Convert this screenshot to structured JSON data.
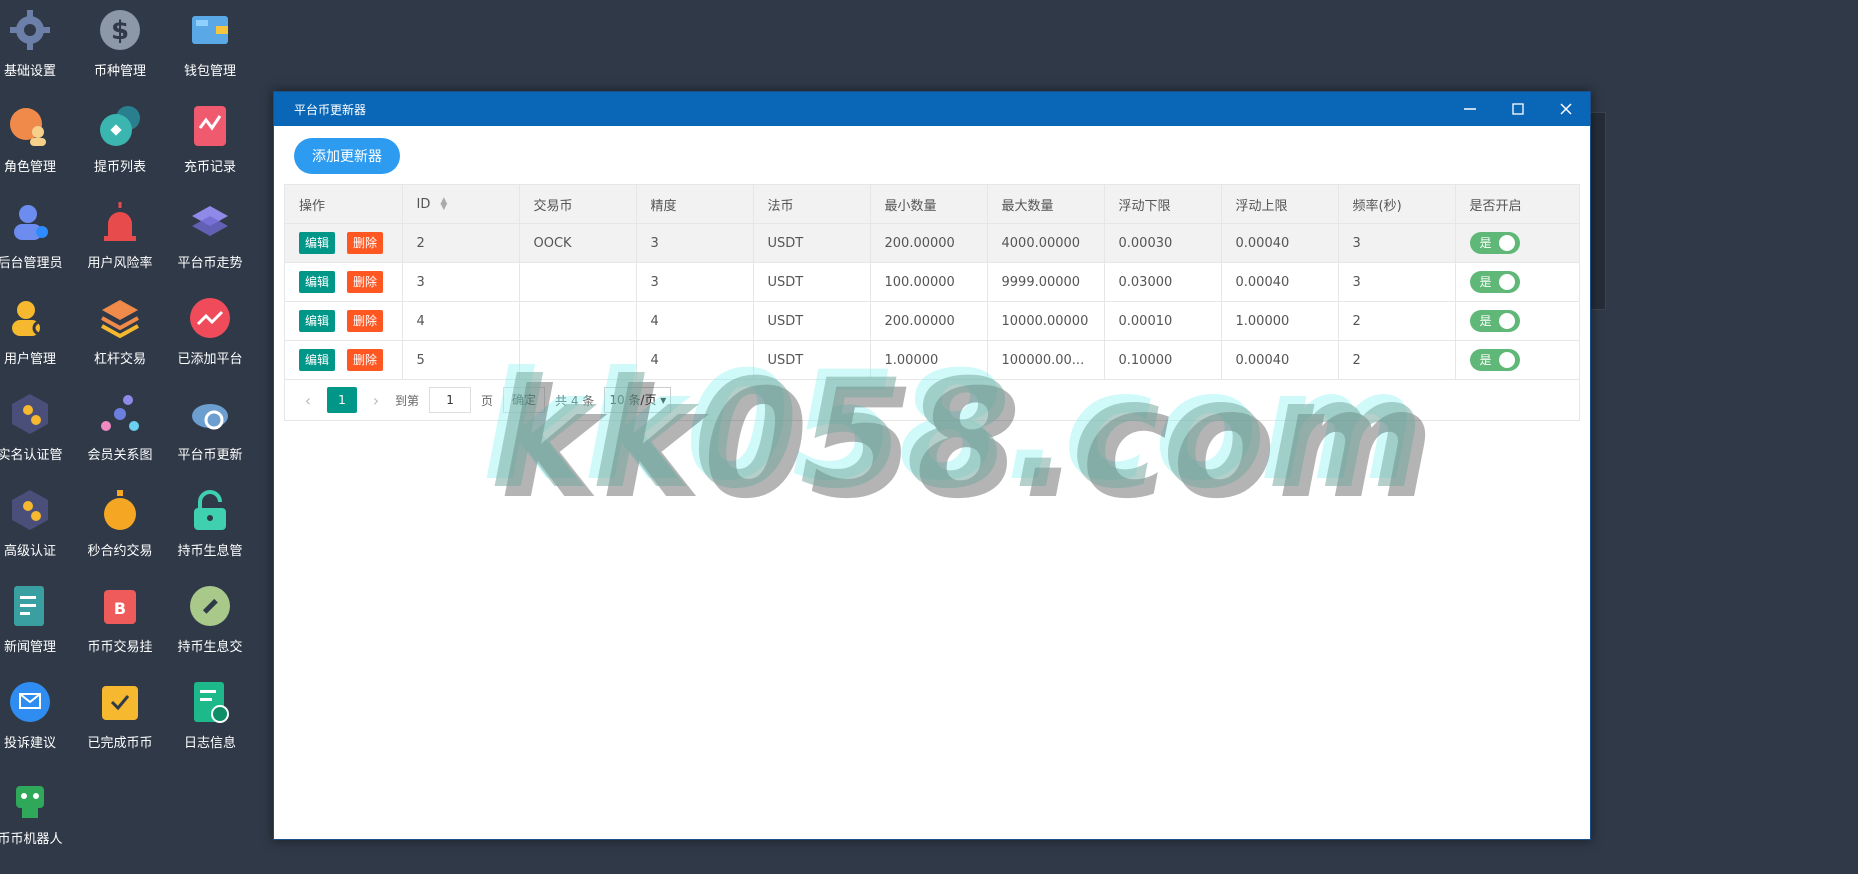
{
  "desktop": {
    "icons": [
      {
        "label": "基础设置",
        "icon": "gear-icon"
      },
      {
        "label": "币种管理",
        "icon": "dollar-icon"
      },
      {
        "label": "钱包管理",
        "icon": "wallet-icon"
      },
      {
        "label": "角色管理",
        "icon": "roles-icon"
      },
      {
        "label": "提币列表",
        "icon": "withdraw-icon"
      },
      {
        "label": "充币记录",
        "icon": "deposit-chart-icon"
      },
      {
        "label": "后台管理员",
        "icon": "admin-icon"
      },
      {
        "label": "用户风险率",
        "icon": "alarm-icon"
      },
      {
        "label": "平台币走势",
        "icon": "layers-icon"
      },
      {
        "label": "用户管理",
        "icon": "user-search-icon"
      },
      {
        "label": "杠杆交易",
        "icon": "stack-icon"
      },
      {
        "label": "已添加平台",
        "icon": "trend-icon"
      },
      {
        "label": "实名认证管",
        "icon": "verify-icon"
      },
      {
        "label": "会员关系图",
        "icon": "network-icon"
      },
      {
        "label": "平台币更新",
        "icon": "cloud-refresh-icon"
      },
      {
        "label": "高级认证",
        "icon": "advanced-verify-icon"
      },
      {
        "label": "秒合约交易",
        "icon": "stopwatch-icon"
      },
      {
        "label": "持币生息管",
        "icon": "lock-icon"
      },
      {
        "label": "新闻管理",
        "icon": "news-icon"
      },
      {
        "label": "币币交易挂",
        "icon": "bitcoin-icon"
      },
      {
        "label": "持币生息交",
        "icon": "hammer-icon"
      },
      {
        "label": "投诉建议",
        "icon": "mail-icon"
      },
      {
        "label": "已完成币币",
        "icon": "check-icon"
      },
      {
        "label": "日志信息",
        "icon": "log-icon"
      },
      {
        "label": "币币机器人",
        "icon": "robot-icon"
      }
    ]
  },
  "window": {
    "title": "平台币更新器",
    "add_label": "添加更新器",
    "columns": [
      "操作",
      "ID",
      "交易币",
      "精度",
      "法币",
      "最小数量",
      "最大数量",
      "浮动下限",
      "浮动上限",
      "频率(秒)",
      "是否开启"
    ],
    "edit_label": "编辑",
    "delete_label": "删除",
    "switch_on_label": "是",
    "rows": [
      {
        "id": "2",
        "coin": "OOCK",
        "precision": "3",
        "fiat": "USDT",
        "min": "200.00000",
        "max": "4000.00000",
        "low": "0.00030",
        "high": "0.00040",
        "freq": "3",
        "enabled": true
      },
      {
        "id": "3",
        "coin": "",
        "precision": "3",
        "fiat": "USDT",
        "min": "100.00000",
        "max": "9999.00000",
        "low": "0.03000",
        "high": "0.00040",
        "freq": "3",
        "enabled": true
      },
      {
        "id": "4",
        "coin": "",
        "precision": "4",
        "fiat": "USDT",
        "min": "200.00000",
        "max": "10000.00000",
        "low": "0.00010",
        "high": "1.00000",
        "freq": "2",
        "enabled": true
      },
      {
        "id": "5",
        "coin": "",
        "precision": "4",
        "fiat": "USDT",
        "min": "1.00000",
        "max": "100000.00...",
        "low": "0.10000",
        "high": "0.00040",
        "freq": "2",
        "enabled": true
      }
    ],
    "pager": {
      "current": "1",
      "goto_label": "到第",
      "goto_value": "1",
      "page_label": "页",
      "confirm_label": "确定",
      "total_label": "共 4 条",
      "per_page": "10 条/页"
    }
  },
  "watermark": "kk058.com",
  "colors": {
    "desktop_bg": "#2f3947",
    "titlebar": "#0a67b8",
    "accent_green": "#009688",
    "danger": "#ff5722",
    "switch": "#5fb878",
    "add_button": "#2d9cf0"
  }
}
